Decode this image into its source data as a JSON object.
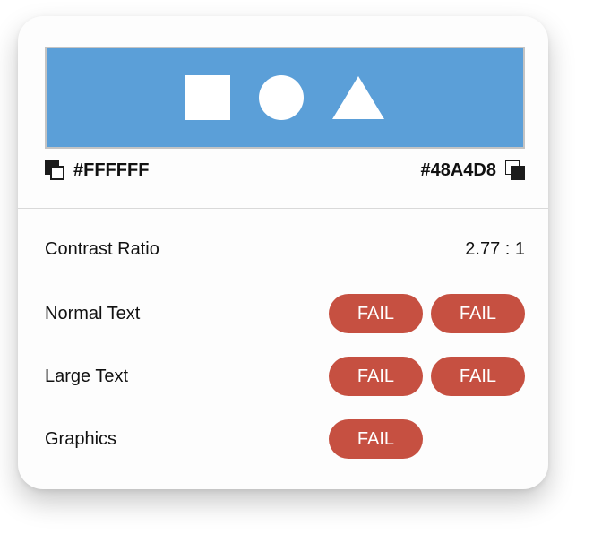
{
  "colors": {
    "foreground": "#FFFFFF",
    "background": "#48A4D8",
    "preview_bg": "#5B9FD8",
    "fail": "#C65041"
  },
  "swatches": {
    "left_label": "#FFFFFF",
    "right_label": "#48A4D8",
    "left_icon": "swap-colors-icon",
    "right_icon": "swap-colors-icon"
  },
  "preview": {
    "shapes": [
      "square",
      "circle",
      "triangle"
    ]
  },
  "results": {
    "contrast": {
      "label": "Contrast Ratio",
      "value": "2.77 : 1"
    },
    "normal_text": {
      "label": "Normal Text",
      "aa": "FAIL",
      "aaa": "FAIL"
    },
    "large_text": {
      "label": "Large Text",
      "aa": "FAIL",
      "aaa": "FAIL"
    },
    "graphics": {
      "label": "Graphics",
      "aa": "FAIL"
    }
  }
}
